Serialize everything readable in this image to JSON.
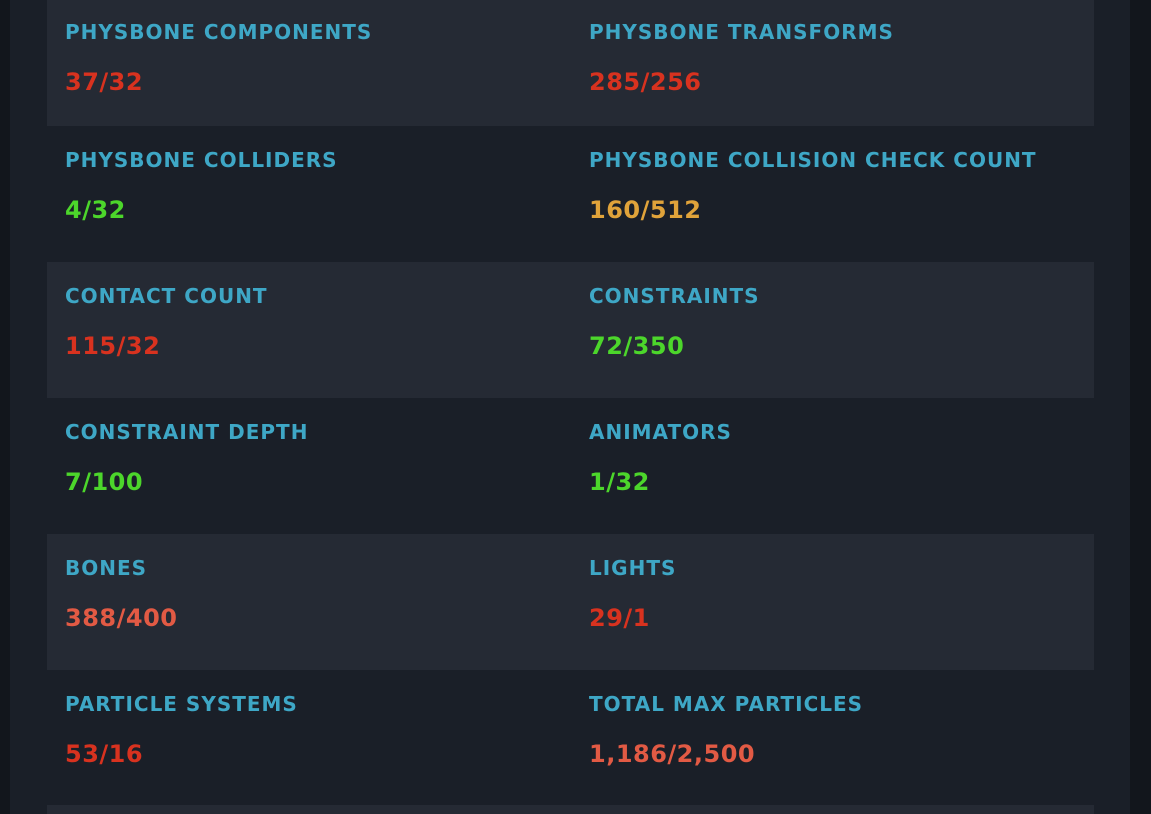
{
  "colors": {
    "label": "#3ea7c6",
    "over": "#d8321f",
    "near": "#e25a44",
    "warn": "#e0a33a",
    "ok": "#4cd62b"
  },
  "stats": [
    {
      "label": "PHYSBONE COMPONENTS",
      "value": "37/32",
      "status": "over"
    },
    {
      "label": "PHYSBONE TRANSFORMS",
      "value": "285/256",
      "status": "over"
    },
    {
      "label": "PHYSBONE COLLIDERS",
      "value": "4/32",
      "status": "ok"
    },
    {
      "label": "PHYSBONE COLLISION CHECK COUNT",
      "value": "160/512",
      "status": "warn"
    },
    {
      "label": "CONTACT COUNT",
      "value": "115/32",
      "status": "over"
    },
    {
      "label": "CONSTRAINTS",
      "value": "72/350",
      "status": "ok"
    },
    {
      "label": "CONSTRAINT DEPTH",
      "value": "7/100",
      "status": "ok"
    },
    {
      "label": "ANIMATORS",
      "value": "1/32",
      "status": "ok"
    },
    {
      "label": "BONES",
      "value": "388/400",
      "status": "near"
    },
    {
      "label": "LIGHTS",
      "value": "29/1",
      "status": "over"
    },
    {
      "label": "PARTICLE SYSTEMS",
      "value": "53/16",
      "status": "over"
    },
    {
      "label": "TOTAL MAX PARTICLES",
      "value": "1,186/2,500",
      "status": "near"
    }
  ]
}
